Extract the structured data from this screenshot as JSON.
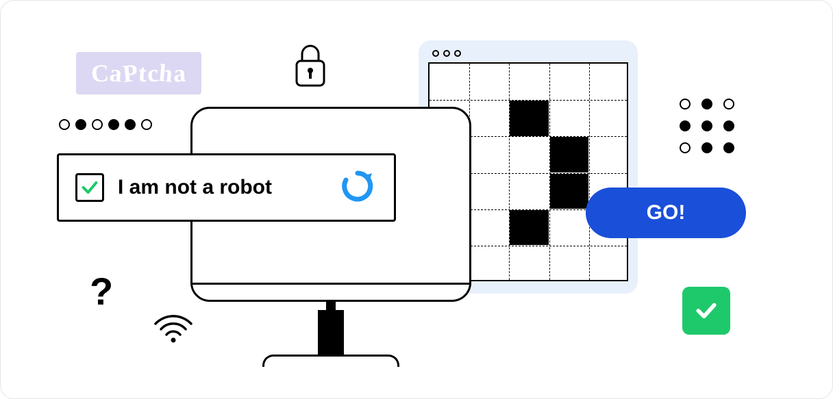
{
  "captcha_badge": {
    "text": "CaPtcha"
  },
  "recaptcha": {
    "checkbox_checked": true,
    "label": "I am not a robot"
  },
  "go_button": {
    "label": "GO!"
  },
  "dot_row_left": [
    "empty",
    "filled",
    "empty",
    "filled",
    "filled",
    "empty"
  ],
  "dot_matrix_right": [
    [
      "empty",
      "filled",
      "empty"
    ],
    [
      "filled",
      "filled",
      "filled"
    ],
    [
      "empty",
      "filled",
      "filled"
    ]
  ],
  "grid": {
    "cols": 5,
    "rows": 6,
    "filled_cells": [
      {
        "col": 2,
        "row": 1
      },
      {
        "col": 3,
        "row": 2
      },
      {
        "col": 3,
        "row": 3
      },
      {
        "col": 2,
        "row": 4
      }
    ]
  },
  "decorations": {
    "question_mark": "?",
    "lock": "lock-icon",
    "wifi": "wifi-icon",
    "reload": "reload-icon",
    "check_square": "check-icon"
  }
}
